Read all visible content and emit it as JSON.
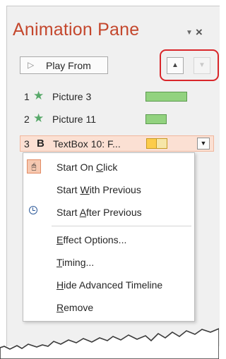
{
  "pane": {
    "title": "Animation Pane",
    "close_symbol": "×",
    "options_symbol": "▼"
  },
  "toolbar": {
    "play_icon": "play-triangle-icon",
    "play_label": "Play From",
    "move_up_symbol": "▲",
    "move_down_symbol": "▼",
    "highlight_color": "#d9262a"
  },
  "animations": [
    {
      "number": "1",
      "icon": "star-icon",
      "name": "Picture 3"
    },
    {
      "number": "2",
      "icon": "star-icon",
      "name": "Picture 11"
    },
    {
      "number": "3",
      "icon": "bold-b",
      "icon_text": "B",
      "name": "TextBox 10: F...",
      "selected": true
    }
  ],
  "selected_dropdown_symbol": "▼",
  "menu": {
    "items": [
      {
        "pre": "Start On ",
        "u": "C",
        "post": "lick",
        "icon": "mouse-click-icon"
      },
      {
        "pre": "Start ",
        "u": "W",
        "post": "ith Previous",
        "icon": ""
      },
      {
        "pre": "Start ",
        "u": "A",
        "post": "fter Previous",
        "icon": "clock-icon"
      },
      {
        "pre": "",
        "u": "E",
        "post": "ffect Options...",
        "icon": ""
      },
      {
        "pre": "",
        "u": "T",
        "post": "iming...",
        "icon": ""
      },
      {
        "pre": "",
        "u": "H",
        "post": "ide Advanced Timeline",
        "icon": ""
      },
      {
        "pre": "",
        "u": "R",
        "post": "emove",
        "icon": ""
      }
    ]
  },
  "colors": {
    "title": "#c4472d",
    "star": "#58a96a",
    "timeline_bar": "#92d27f",
    "selected_row": "#fbe0d3",
    "text_bar_light": "#f6e6a8",
    "text_bar_dark": "#fccc4a"
  }
}
